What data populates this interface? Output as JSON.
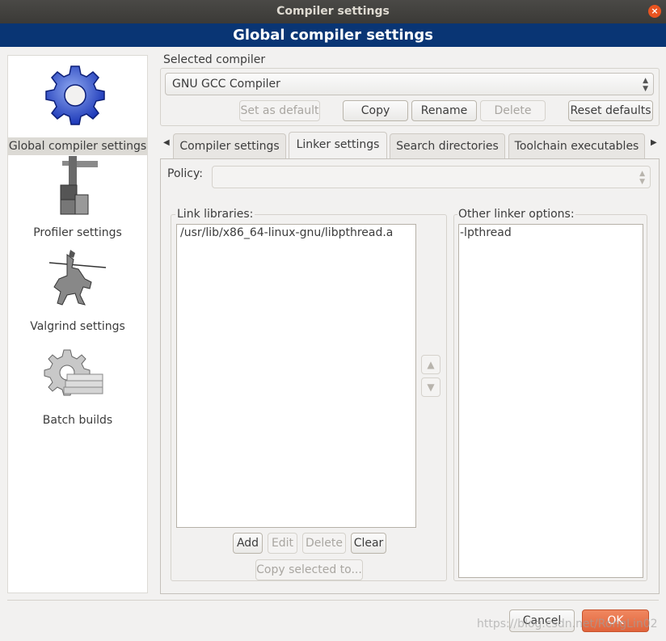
{
  "window": {
    "title": "Compiler settings",
    "close_icon": "×"
  },
  "header": {
    "title": "Global compiler settings"
  },
  "sidebar": {
    "items": [
      {
        "label": "Global compiler settings",
        "icon": "gear-icon"
      },
      {
        "label": "Profiler settings",
        "icon": "profiler-icon"
      },
      {
        "label": "Valgrind settings",
        "icon": "knight-icon"
      },
      {
        "label": "Batch builds",
        "icon": "batch-gear-icon"
      }
    ]
  },
  "compiler": {
    "group_label": "Selected compiler",
    "selected": "GNU GCC Compiler",
    "buttons": {
      "set_default": "Set as default",
      "copy": "Copy",
      "rename": "Rename",
      "delete": "Delete",
      "reset": "Reset defaults"
    }
  },
  "tabs": [
    "Compiler settings",
    "Linker settings",
    "Search directories",
    "Toolchain executables"
  ],
  "tab_arrows": {
    "left": "◀",
    "right": "▶"
  },
  "linker": {
    "policy_label": "Policy:",
    "policy_value": "",
    "link_libraries_label": "Link libraries:",
    "link_libraries": [
      "/usr/lib/x86_64-linux-gnu/libpthread.a"
    ],
    "other_options_label": "Other linker options:",
    "other_options": "-lpthread",
    "buttons": {
      "add": "Add",
      "edit": "Edit",
      "delete": "Delete",
      "clear": "Clear",
      "copy_selected": "Copy selected to..."
    },
    "up_arrow": "▲",
    "down_arrow": "▼"
  },
  "footer": {
    "cancel": "Cancel",
    "ok": "OK",
    "watermark": "https://blog.csdn.net/RongLin02"
  },
  "colors": {
    "header_bg": "#093574",
    "accent": "#e95420",
    "titlebar": "#3b3a37"
  }
}
